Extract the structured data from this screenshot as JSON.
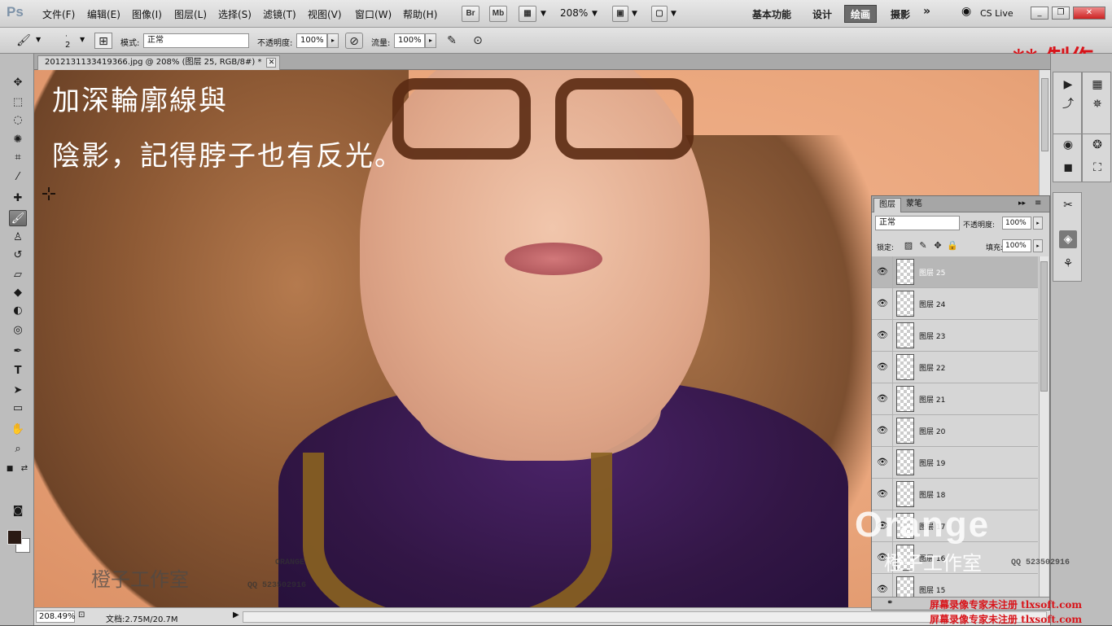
{
  "app": {
    "logo": "Ps",
    "menu": [
      "文件(F)",
      "编辑(E)",
      "图像(I)",
      "图层(L)",
      "选择(S)",
      "滤镜(T)",
      "视图(V)",
      "窗口(W)",
      "帮助(H)"
    ],
    "bridge_buttons": [
      "Br",
      "Mb"
    ],
    "zoom_menu": "208%",
    "workspaces": [
      "基本功能",
      "设计",
      "绘画",
      "摄影"
    ],
    "active_workspace": "绘画",
    "overflow": "»",
    "cs_live": "CS Live",
    "watermark_top": "** 制作"
  },
  "options": {
    "brush_size": "2",
    "mode_label": "模式:",
    "mode_value": "正常",
    "opacity_label": "不透明度:",
    "opacity_value": "100%",
    "flow_label": "流量:",
    "flow_value": "100%"
  },
  "document": {
    "tab_title": "20121311334193​66.jpg @ 208% (图层 25, RGB/8#) *",
    "caption_line1": "加深輪廓線與",
    "caption_line2": "陰影，記得脖子也有反光。",
    "studio_watermark": "橙子工作室",
    "qq_watermark": "QQ 523502916",
    "orange_word": "ORANGE"
  },
  "status": {
    "zoom": "208.49%",
    "doc_info": "文档:2.75M/20.7M"
  },
  "layers_panel": {
    "tabs": [
      "图层",
      "蒙笔"
    ],
    "blend_mode": "正常",
    "opacity_label": "不透明度:",
    "opacity_value": "100%",
    "lock_label": "锁定:",
    "fill_label": "填充:",
    "fill_value": "100%",
    "layers": [
      {
        "name": "图层 25",
        "selected": true
      },
      {
        "name": "图层 24",
        "selected": false
      },
      {
        "name": "图层 23",
        "selected": false
      },
      {
        "name": "图层 22",
        "selected": false
      },
      {
        "name": "图层 21",
        "selected": false
      },
      {
        "name": "图层 20",
        "selected": false
      },
      {
        "name": "图层 19",
        "selected": false
      },
      {
        "name": "图层 18",
        "selected": false
      },
      {
        "name": "图层 17",
        "selected": false
      },
      {
        "name": "图层 16",
        "selected": false
      },
      {
        "name": "图层 15",
        "selected": false
      }
    ]
  },
  "bottom_watermarks": {
    "studio": "橙子工作室",
    "qq": "QQ 523502916",
    "logo": "Orange",
    "recorder_line1": "屏幕录像专家未注册 tlxsoft.com",
    "recorder_line2": "屏幕录像专家未注册 tlxsoft.com"
  },
  "colors": {
    "accent_red": "#d8141a",
    "foreground": "#2a1a14",
    "background": "#ffffff"
  }
}
